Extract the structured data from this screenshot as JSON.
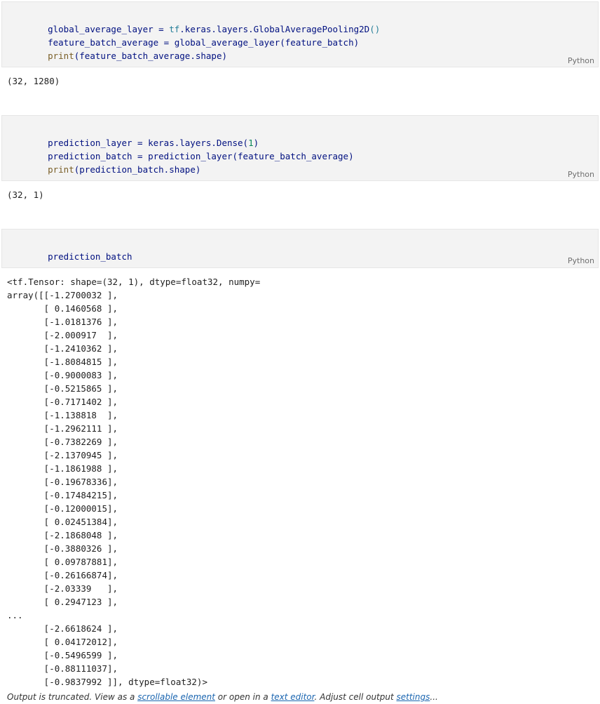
{
  "cells": [
    {
      "code_lines": [
        [
          "global_average_layer = ",
          "tf",
          ".keras.layers.GlobalAveragePooling2D",
          "()"
        ],
        [
          "feature_batch_average = global_average_layer(feature_batch)"
        ],
        [
          "print",
          "(feature_batch_average.shape)"
        ]
      ],
      "language": "Python",
      "output": "(32, 1280)"
    },
    {
      "code_lines": [
        [
          "prediction_layer = keras.layers.Dense(",
          "1",
          ")"
        ],
        [
          "prediction_batch = prediction_layer(feature_batch_average)"
        ],
        [
          "print",
          "(prediction_batch.shape)"
        ]
      ],
      "language": "Python",
      "output": "(32, 1)"
    },
    {
      "code_lines": [
        [
          "prediction_batch"
        ]
      ],
      "language": "Python",
      "output_lines": [
        "<tf.Tensor: shape=(32, 1), dtype=float32, numpy=",
        "array([[-1.2700032 ],",
        "       [ 0.1460568 ],",
        "       [-1.0181376 ],",
        "       [-2.000917  ],",
        "       [-1.2410362 ],",
        "       [-1.8084815 ],",
        "       [-0.9000083 ],",
        "       [-0.5215865 ],",
        "       [-0.7171402 ],",
        "       [-1.138818  ],",
        "       [-1.2962111 ],",
        "       [-0.7382269 ],",
        "       [-2.1370945 ],",
        "       [-1.1861988 ],",
        "       [-0.19678336],",
        "       [-0.17484215],",
        "       [-0.12000015],",
        "       [ 0.02451384],",
        "       [-2.1868048 ],",
        "       [-0.3880326 ],",
        "       [ 0.09787881],",
        "       [-0.26166874],",
        "       [-2.03339   ],",
        "       [ 0.2947123 ],",
        "...",
        "       [-2.6618624 ],",
        "       [ 0.04172012],",
        "       [-0.5496599 ],",
        "       [-0.88111037],",
        "       [-0.9837992 ]], dtype=float32)>"
      ]
    }
  ],
  "truncation_note": {
    "prefix": "Output is truncated. View as a ",
    "link1": "scrollable element",
    "mid1": " or open in a ",
    "link2": "text editor",
    "mid2": ". Adjust cell output ",
    "link3": "settings",
    "suffix": "..."
  },
  "colors": {
    "cell_bg": "#f3f3f3",
    "link": "#1a65b0"
  }
}
